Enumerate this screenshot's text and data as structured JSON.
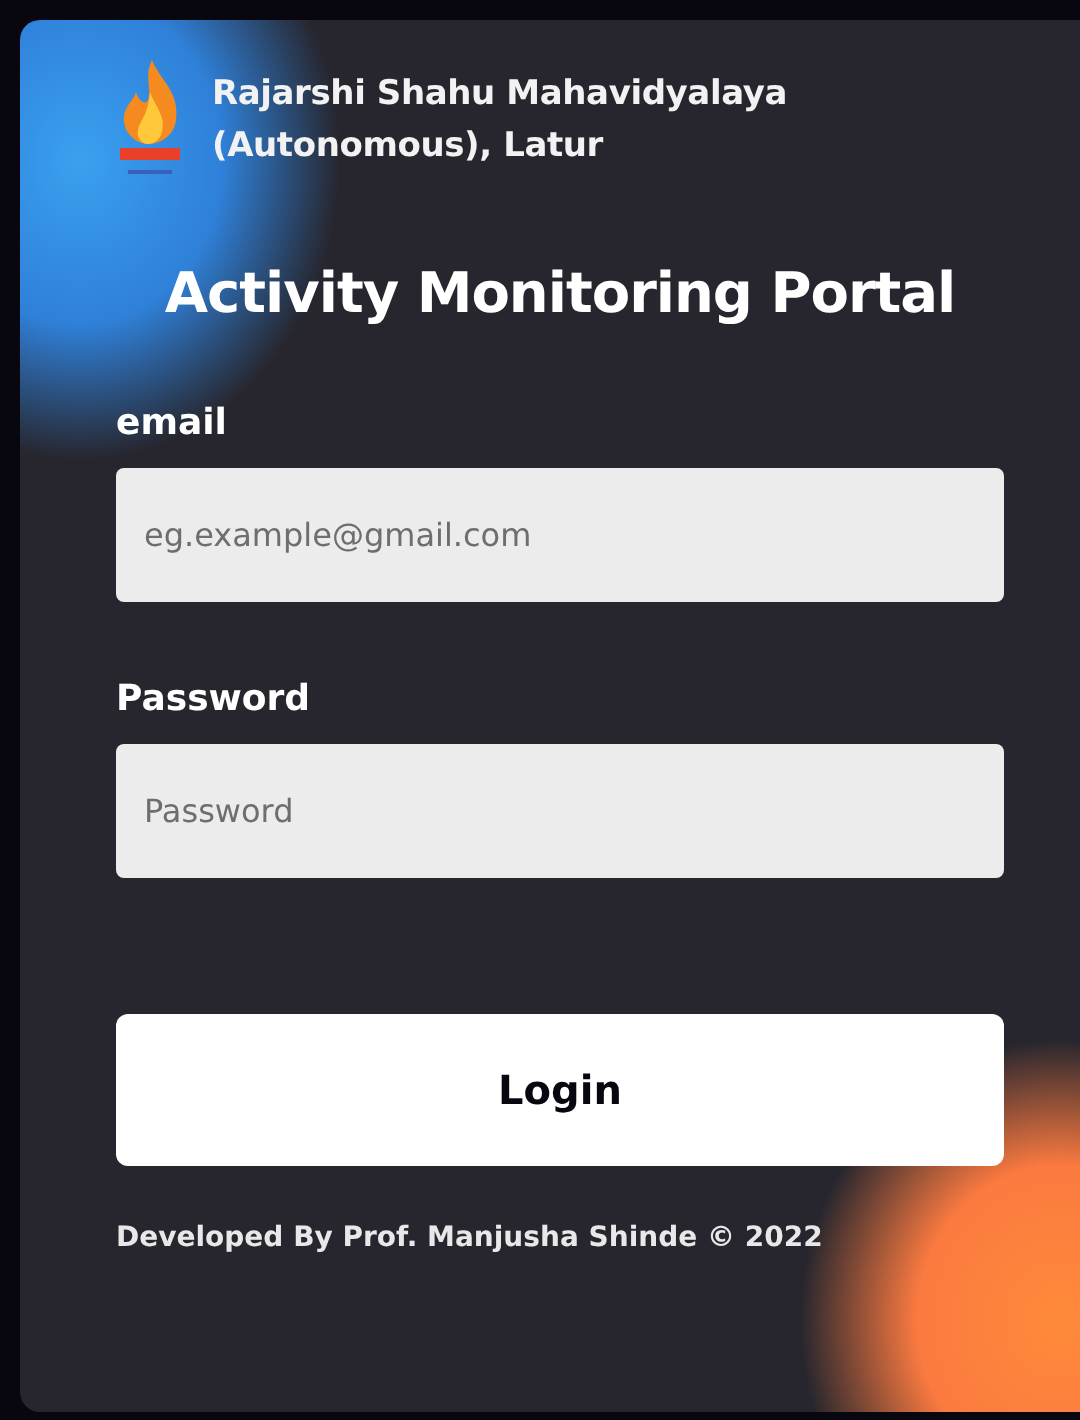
{
  "college": {
    "name_line_1": "Rajarshi Shahu Mahavidyalaya",
    "name_line_2": "(Autonomous), Latur"
  },
  "title": "Activity Monitoring Portal",
  "fields": [
    {
      "label": "email",
      "placeholder": "eg.example@gmail.com"
    },
    {
      "label": "Password",
      "placeholder": "Password"
    }
  ],
  "button": "Login",
  "footer": "Developed By Prof. Manjusha Shinde © 2022"
}
